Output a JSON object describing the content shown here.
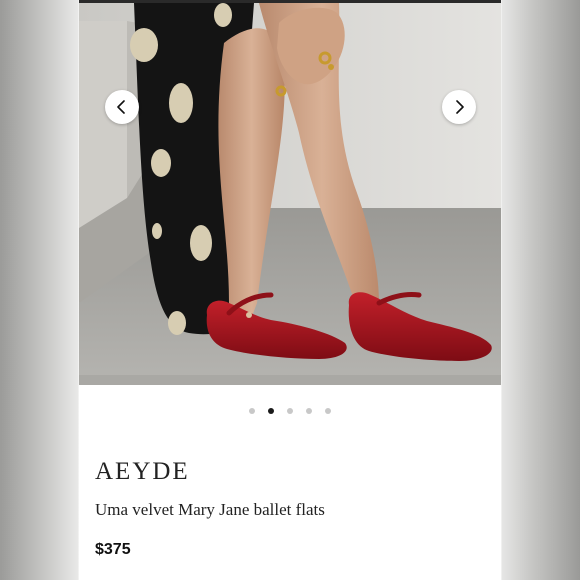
{
  "gallery": {
    "image_alt": "Model wearing red velvet Mary Jane ballet flats",
    "prev_icon": "chevron-left-icon",
    "next_icon": "chevron-right-icon",
    "slide_count": 5,
    "active_index": 1
  },
  "product": {
    "brand": "AEYDE",
    "name": "Uma velvet Mary Jane ballet flats",
    "price": "$375"
  },
  "colors": {
    "shoe": "#a8141c",
    "active_dot": "#1a1a1a",
    "inactive_dot": "#c8c8c8"
  }
}
